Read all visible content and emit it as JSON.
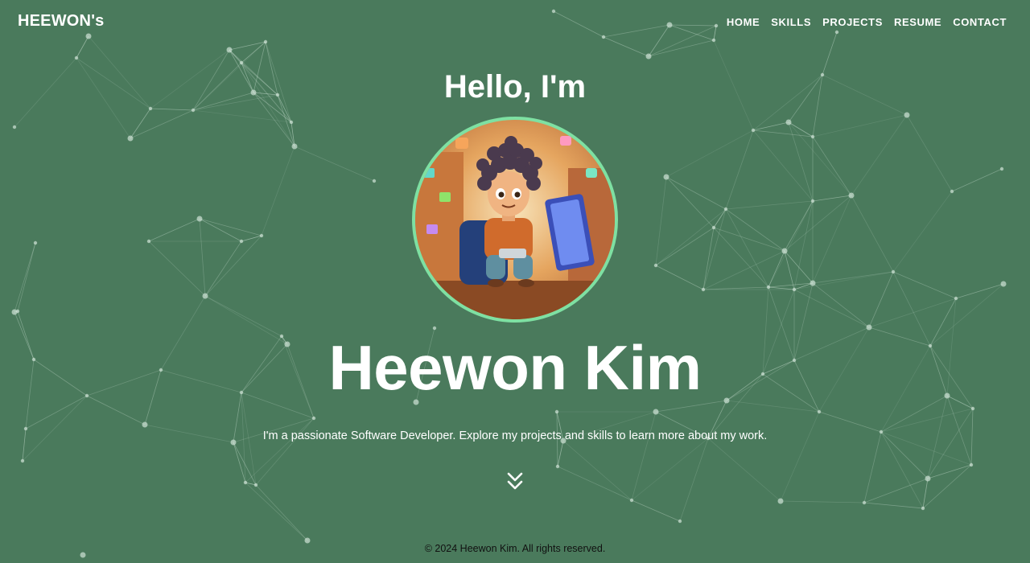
{
  "brand": "HEEWON's",
  "nav": {
    "home": "HOME",
    "skills": "SKILLS",
    "projects": "PROJECTS",
    "resume": "RESUME",
    "contact": "CONTACT"
  },
  "hero": {
    "greeting": "Hello, I'm",
    "name": "Heewon Kim",
    "tagline": "I'm a passionate Software Developer. Explore my projects and skills to learn more about my work.",
    "scroll_icon": "double-chevron-down-icon"
  },
  "footer": {
    "copyright": "© 2024 Heewon Kim. All rights reserved."
  },
  "colors": {
    "background": "#4a7a5c",
    "avatar_ring": "#7ee0a2",
    "text": "#ffffff",
    "footer_text": "#111111",
    "network_lines": "#cfe3d6"
  }
}
